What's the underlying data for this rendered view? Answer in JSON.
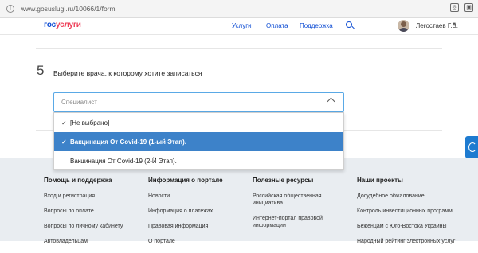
{
  "browser": {
    "url": "www.gosuslugi.ru/10066/1/form"
  },
  "header": {
    "logo_part1": "гос",
    "logo_part2": "услуги",
    "nav": [
      "Услуги",
      "Оплата",
      "Поддержка"
    ],
    "user_name": "Легостаев Г.В."
  },
  "form": {
    "step_number": "5",
    "step_title": "Выберите врача, к которому хотите записаться",
    "select_placeholder": "Специалист",
    "options": [
      {
        "label": "[Не выбрано]",
        "checked": true,
        "highlighted": false
      },
      {
        "label": "Вакцинация От Covid-19 (1-ый Этап).",
        "checked": true,
        "highlighted": true
      },
      {
        "label": "Вакцинация От Covid-19 (2-Й Этап).",
        "checked": false,
        "highlighted": false
      }
    ]
  },
  "footer": {
    "columns": [
      {
        "title": "Помощь и поддержка",
        "links": [
          "Вход и регистрация",
          "Вопросы по оплате",
          "Вопросы по личному кабинету",
          "Автовладельцам"
        ]
      },
      {
        "title": "Информация о портале",
        "links": [
          "Новости",
          "Информация о платежах",
          "Правовая информация",
          "О портале"
        ]
      },
      {
        "title": "Полезные ресурсы",
        "links": [
          "Российская общественная инициатива",
          "Интернет-портал правовой информации"
        ]
      },
      {
        "title": "Наши проекты",
        "links": [
          "Досудебное обжалование",
          "Контроль инвестиционных программ",
          "Беженцам с Юго-Востока Украины",
          "Народный рейтинг электронных услуг"
        ]
      }
    ]
  },
  "colors": {
    "brand_blue": "#0d4cd3",
    "brand_red": "#ee3f58",
    "selected_option": "#3d82c9",
    "footer_bg": "#e9edf1"
  }
}
